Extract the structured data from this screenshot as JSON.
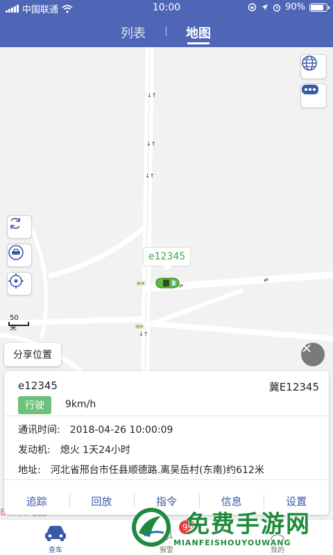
{
  "status_bar": {
    "carrier": "中国联通",
    "time": "10:00",
    "battery": "90%",
    "battery_level": 0.9
  },
  "header": {
    "tabs": [
      {
        "label": "列表",
        "active": false
      },
      {
        "label": "地图",
        "active": true
      }
    ],
    "background_color": "#4f66b6"
  },
  "map": {
    "scale_label": "50米",
    "vehicle_label": "e12345",
    "share_label": "分享位置",
    "controls_right": [
      "globe-icon",
      "more-icon"
    ],
    "controls_left": [
      "refresh-icon",
      "car-center-icon",
      "locate-icon"
    ]
  },
  "vehicle_card": {
    "id": "e12345",
    "plate": "冀E12345",
    "status": "行驶",
    "speed": "9km/h",
    "rows": [
      {
        "label": "通讯时间:",
        "value": "2018-04-26 10:00:09"
      },
      {
        "label": "发动机:",
        "value": "熄火 1天24小时"
      },
      {
        "label": "地址:",
        "value": "河北省邢台市任县顺德路.离吴岳村(东南)约612米"
      }
    ],
    "actions": [
      "追踪",
      "回放",
      "指令",
      "信息",
      "设置"
    ]
  },
  "bottom_nav": {
    "items": [
      {
        "label": "查车",
        "active": true
      },
      {
        "label": "报警",
        "active": false
      },
      {
        "label": "我的",
        "active": false
      }
    ],
    "alarm_badge": "99"
  },
  "watermark": {
    "map_logo": "Baidu地图",
    "title": "免费手游网",
    "subtitle": "MIANFEISHOUYOUWANG"
  }
}
